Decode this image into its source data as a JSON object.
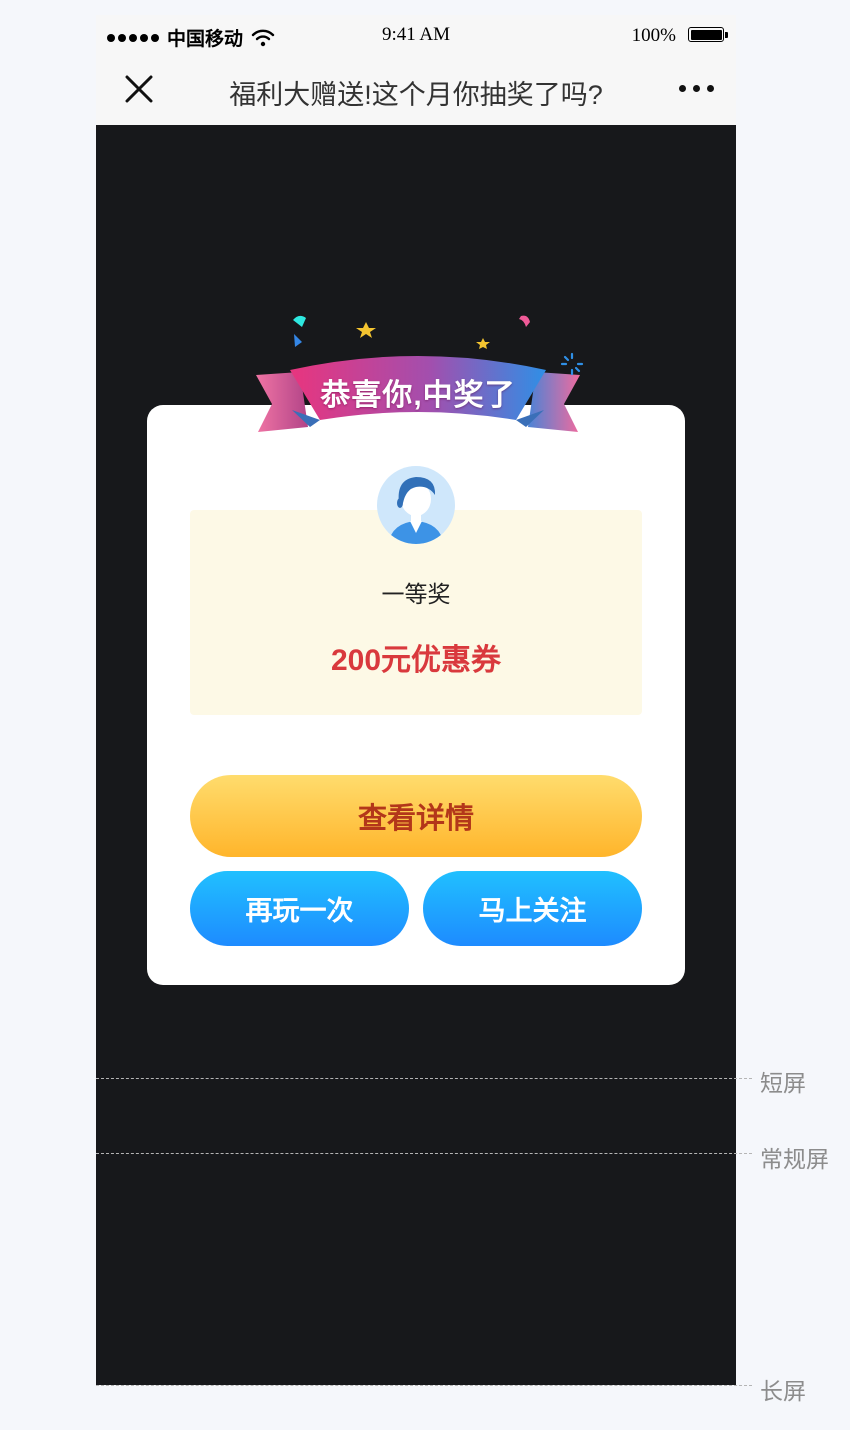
{
  "status_bar": {
    "carrier": "中国移动",
    "time": "9:41 AM",
    "battery": "100%"
  },
  "nav": {
    "title": "福利大赠送!这个月你抽奖了吗?"
  },
  "modal": {
    "banner": "恭喜你,中奖了",
    "prize_level": "一等奖",
    "prize_name": "200元优惠券",
    "details_button": "查看详情",
    "replay_button": "再玩一次",
    "follow_button": "马上关注"
  },
  "guides": {
    "short": "短屏",
    "regular": "常规屏",
    "long": "长屏"
  },
  "colors": {
    "overlay": "#17181b",
    "prize_red": "#d9393d",
    "details_gradient": [
      "#ffdc6d",
      "#ffb52b"
    ],
    "blue_gradient": [
      "#20c0ff",
      "#1e8bff"
    ],
    "prize_panel": "#fdf9e6"
  },
  "icons": {
    "close": "close-icon",
    "more": "more-icon",
    "wifi": "wifi-icon",
    "battery": "battery-icon",
    "avatar": "user-avatar-icon",
    "ribbon": "ribbon-banner"
  }
}
